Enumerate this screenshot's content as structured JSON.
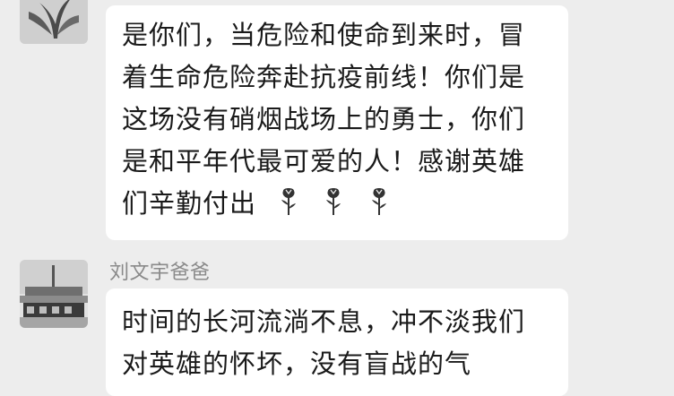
{
  "chat": {
    "message1": {
      "lines": [
        "是你们，当危险和使命到来时，冒",
        "着生命危险奔赴抗疫前线！你们是",
        "这场没有硝烟战场上的勇士，你们",
        "是和平年代最可爱的人！感谢英雄",
        "们辛勤付出"
      ],
      "emoji": [
        "rose-icon",
        "rose-icon",
        "rose-icon"
      ]
    },
    "message2": {
      "sender": "刘文宇爸爸",
      "lines": [
        "时间的长河流淌不息，冲不淡我们",
        "对英雄的怀坏，没有盲战的气"
      ]
    }
  },
  "colors": {
    "background": "#ededed",
    "bubble": "#ffffff",
    "text": "#1a1a1a",
    "sender": "#8a8a8a"
  }
}
